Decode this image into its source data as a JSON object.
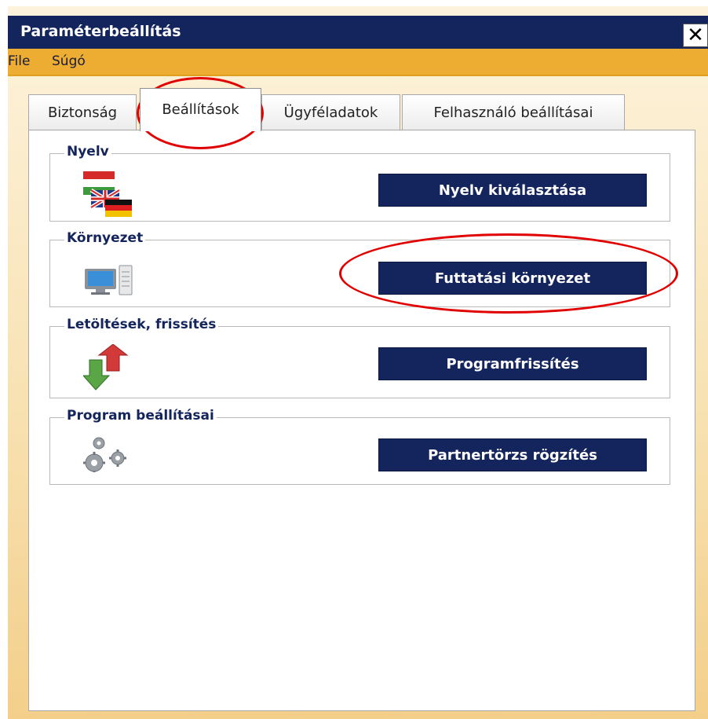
{
  "window": {
    "title": "Paraméterbeállítás",
    "close_label": "✕"
  },
  "menu": {
    "items": [
      {
        "label": "File"
      },
      {
        "label": "Súgó"
      }
    ]
  },
  "tabs": [
    {
      "label": "Biztonság"
    },
    {
      "label": "Beállítások",
      "active": true
    },
    {
      "label": "Ügyféladatok"
    },
    {
      "label": "Felhasználó beállításai"
    }
  ],
  "groups": [
    {
      "legend": "Nyelv",
      "button": "Nyelv kiválasztása",
      "icon": "language-flags-icon"
    },
    {
      "legend": "Környezet",
      "button": "Futtatási környezet",
      "icon": "computer-icon"
    },
    {
      "legend": "Letöltések, frissítés",
      "button": "Programfrissítés",
      "icon": "update-arrows-icon"
    },
    {
      "legend": "Program beállításai",
      "button": "Partnertörzs rögzítés",
      "icon": "gears-icon"
    }
  ],
  "colors": {
    "titlebar": "#14245c",
    "menubar": "#ecad32",
    "button": "#14245c",
    "annotation": "#e10000"
  }
}
